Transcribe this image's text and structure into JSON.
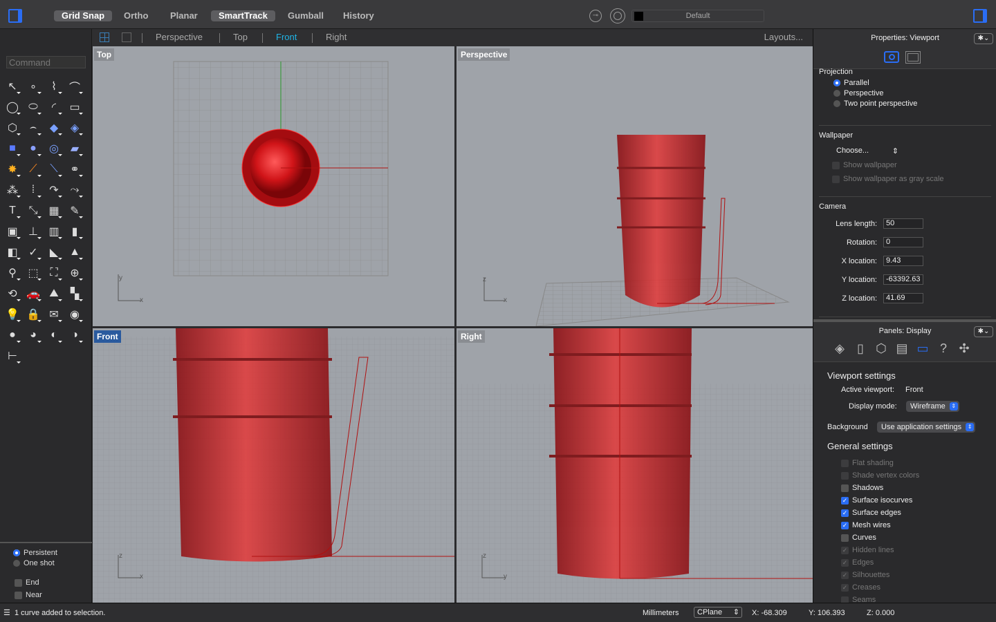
{
  "topbar": {
    "toggles": [
      {
        "label": "Grid Snap",
        "on": true
      },
      {
        "label": "Ortho",
        "on": false
      },
      {
        "label": "Planar",
        "on": false
      },
      {
        "label": "SmartTrack",
        "on": true
      },
      {
        "label": "Gumball",
        "on": false
      },
      {
        "label": "History",
        "on": false
      }
    ],
    "layer": "Default",
    "layer_color": "#000000"
  },
  "tabs": {
    "items": [
      "Perspective",
      "Top",
      "Front",
      "Right"
    ],
    "active": "Front",
    "layouts": "Layouts..."
  },
  "command": {
    "placeholder": "Command"
  },
  "tools": [
    "select-arrow-icon",
    "point-icon",
    "polyline-icon",
    "curve-icon",
    "circle-icon",
    "ellipse-icon",
    "arc-icon",
    "rectangle-icon",
    "polygon-icon",
    "fillet-curve-icon",
    "surface-icon",
    "extrude-surface-icon",
    "box-icon",
    "sphere-icon",
    "torus-icon",
    "plane-icon",
    "explode-icon",
    "trim-icon",
    "split-icon",
    "boolean-icon",
    "group-icon",
    "array-icon",
    "offset-icon",
    "blend-icon",
    "text-icon",
    "transform-icon",
    "grid-snap-icon",
    "paint-icon",
    "solid-tools-icon",
    "dimension-icon",
    "mesh-icon",
    "section-icon",
    "analysis-icon",
    "check-icon",
    "fillet-icon",
    "cone-icon",
    "zoom-icon",
    "zoom-window-icon",
    "zoom-extents-icon",
    "zoom-selected-icon",
    "rotate-view-icon",
    "car-icon",
    "terrain-icon",
    "layer-tools-icon",
    "light-icon",
    "lock-icon",
    "render-icon",
    "color-wheel-icon",
    "shade-sphere-icon",
    "material-sphere-icon",
    "environment-icon",
    "render-preview-icon",
    "history-tree-icon"
  ],
  "osnap": {
    "mode": [
      {
        "label": "Persistent",
        "on": true
      },
      {
        "label": "One shot",
        "on": false
      }
    ],
    "snaps": [
      {
        "label": "End",
        "on": false
      },
      {
        "label": "Near",
        "on": false
      }
    ]
  },
  "viewports": {
    "top": "Top",
    "perspective": "Perspective",
    "front": "Front",
    "right": "Right"
  },
  "properties": {
    "title": "Properties: Viewport",
    "gear": "✱⌄",
    "projection": {
      "title": "Projection",
      "options": [
        {
          "label": "Parallel",
          "on": true
        },
        {
          "label": "Perspective",
          "on": false
        },
        {
          "label": "Two point perspective",
          "on": false
        }
      ]
    },
    "wallpaper": {
      "title": "Wallpaper",
      "choose": "Choose...",
      "show": "Show wallpaper",
      "gray": "Show wallpaper as gray scale"
    },
    "camera": {
      "title": "Camera",
      "fields": [
        {
          "label": "Lens length:",
          "value": "50"
        },
        {
          "label": "Rotation:",
          "value": "0"
        },
        {
          "label": "X location:",
          "value": "9.43"
        },
        {
          "label": "Y location:",
          "value": "-63392.63"
        },
        {
          "label": "Z location:",
          "value": "41.69"
        }
      ]
    }
  },
  "display": {
    "title": "Panels: Display",
    "gear": "✱⌄",
    "icons": [
      "layers-icon",
      "document-icon",
      "object-cube-icon",
      "notes-icon",
      "display-monitor-icon",
      "help-icon",
      "navigation-icon"
    ],
    "viewport_settings": "Viewport settings",
    "active_label": "Active viewport:",
    "active_value": "Front",
    "mode_label": "Display mode:",
    "mode_value": "Wireframe",
    "bg_label": "Background",
    "bg_value": "Use application settings",
    "general": "General settings",
    "checks": [
      {
        "label": "Flat shading",
        "checked": false,
        "enabled": false
      },
      {
        "label": "Shade vertex colors",
        "checked": false,
        "enabled": false
      },
      {
        "label": "Shadows",
        "checked": false,
        "enabled": true
      },
      {
        "label": "Surface isocurves",
        "checked": true,
        "enabled": true
      },
      {
        "label": "Surface edges",
        "checked": true,
        "enabled": true
      },
      {
        "label": "Mesh wires",
        "checked": true,
        "enabled": true
      },
      {
        "label": "Curves",
        "checked": false,
        "enabled": true
      },
      {
        "label": "Hidden lines",
        "checked": true,
        "enabled": false
      },
      {
        "label": "Edges",
        "checked": true,
        "enabled": false
      },
      {
        "label": "Silhouettes",
        "checked": true,
        "enabled": false
      },
      {
        "label": "Creases",
        "checked": true,
        "enabled": false
      },
      {
        "label": "Seams",
        "checked": false,
        "enabled": false
      }
    ]
  },
  "status": {
    "message": "1 curve added to selection.",
    "units": "Millimeters",
    "cplane": "CPlane",
    "x": "X: -68.309",
    "y": "Y: 106.393",
    "z": "Z: 0.000"
  },
  "colors": {
    "accent": "#2a6df4",
    "model": "#c8141a",
    "viewport_bg": "#9fa3a9"
  }
}
